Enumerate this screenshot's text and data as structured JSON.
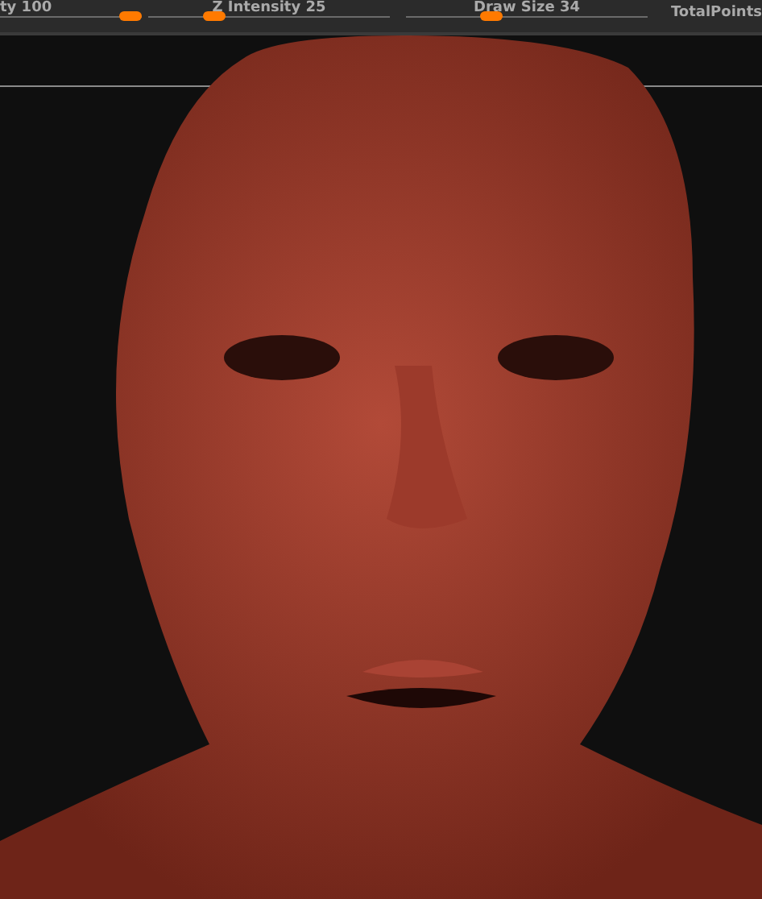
{
  "toolbar": {
    "sliders": [
      {
        "label": "ty 100",
        "level": 1
      },
      {
        "label": "Z Intensity 25",
        "level": 0.25
      },
      {
        "label": "Draw Size 34",
        "level": 0.34
      }
    ],
    "stat_label": "TotalPoints"
  }
}
